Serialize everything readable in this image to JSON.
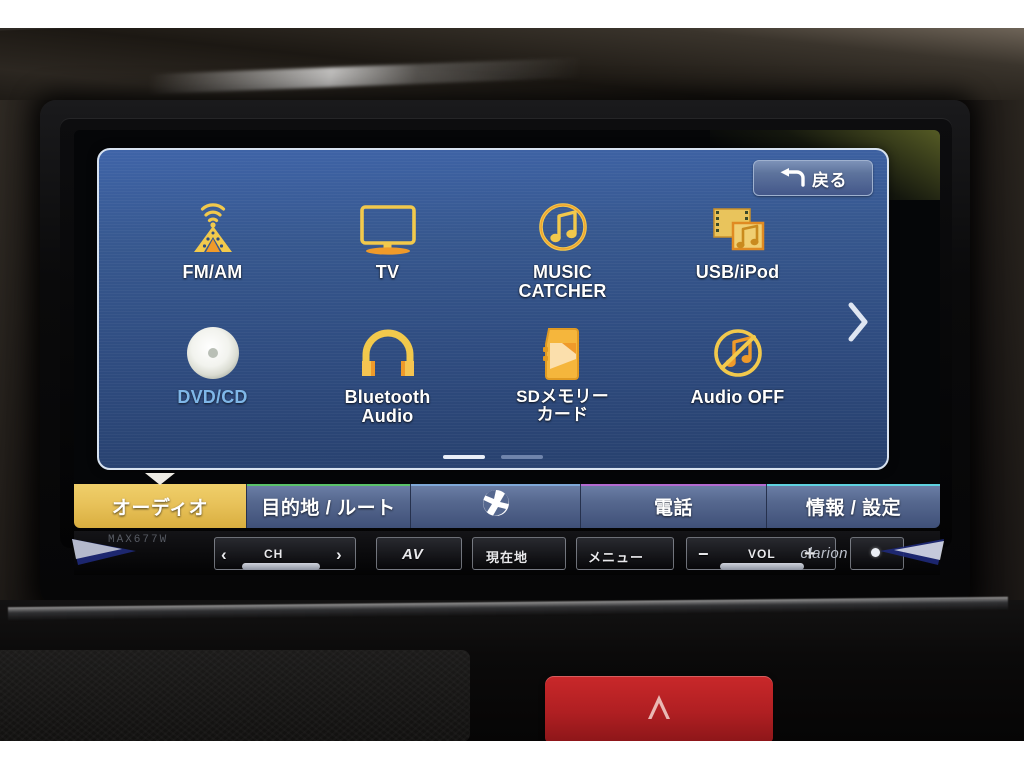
{
  "device": {
    "brand": "clarion",
    "model": "MAX677W"
  },
  "colors": {
    "screen_bg_top": "#3f64a8",
    "screen_bg_bottom": "#27406d",
    "icon_yellow": "#f2c94c",
    "icon_orange": "#ef9a2a",
    "active_tab": "#e8c25a",
    "inactive_tab": "#56688f",
    "disabled_label": "#7fb7e8",
    "hazard_red": "#c9282a"
  },
  "screen": {
    "back_button": {
      "label": "戻る",
      "icon": "back-arrow-icon"
    },
    "menu_items": [
      {
        "label": "FM/AM",
        "icon": "radio-tower-icon",
        "state": "enabled"
      },
      {
        "label": "TV",
        "icon": "television-icon",
        "state": "enabled"
      },
      {
        "label": "MUSIC\nCATCHER",
        "line1": "MUSIC",
        "line2": "CATCHER",
        "icon": "music-note-circle-icon",
        "state": "enabled"
      },
      {
        "label": "USB/iPod",
        "icon": "usb-media-icon",
        "state": "enabled"
      },
      {
        "label": "DVD/CD",
        "icon": "disc-icon",
        "state": "disabled"
      },
      {
        "label": "Bluetooth\nAudio",
        "line1": "Bluetooth",
        "line2": "Audio",
        "icon": "headphones-icon",
        "state": "enabled"
      },
      {
        "label": "SDメモリーカード",
        "line1": "SDメモリー",
        "line2": "カード",
        "icon": "sd-card-icon",
        "state": "enabled"
      },
      {
        "label": "Audio OFF",
        "icon": "audio-off-icon",
        "state": "enabled"
      }
    ],
    "next_page_arrow": "chevron-right-icon",
    "pagination": {
      "total": 2,
      "current": 1
    }
  },
  "tabs": [
    {
      "label": "オーディオ",
      "id": "audio",
      "active": true,
      "accent": "#d9ae3f"
    },
    {
      "label": "目的地 / ルート",
      "id": "destination-route",
      "active": false,
      "accent": "#5ac26a"
    },
    {
      "label": "",
      "id": "map",
      "active": false,
      "icon": "globe-icon",
      "accent": "#7fa8d8"
    },
    {
      "label": "電話",
      "id": "phone",
      "active": false,
      "accent": "#b46ad0"
    },
    {
      "label": "情報 / 設定",
      "id": "info-settings",
      "active": false,
      "accent": "#5fd2e0"
    }
  ],
  "hardware_buttons": [
    {
      "label": "CH",
      "id": "channel",
      "icon": "prev-next-icon"
    },
    {
      "label": "AV",
      "id": "av"
    },
    {
      "label": "現在地",
      "id": "current-location"
    },
    {
      "label": "メニュー",
      "id": "menu"
    },
    {
      "label": "VOL",
      "id": "volume",
      "icon": "minus-plus-icon"
    },
    {
      "label": "",
      "id": "power",
      "icon": "power-dot-icon"
    }
  ],
  "console": {
    "hazard_button": {
      "icon": "hazard-triangle-icon",
      "label": ""
    }
  }
}
